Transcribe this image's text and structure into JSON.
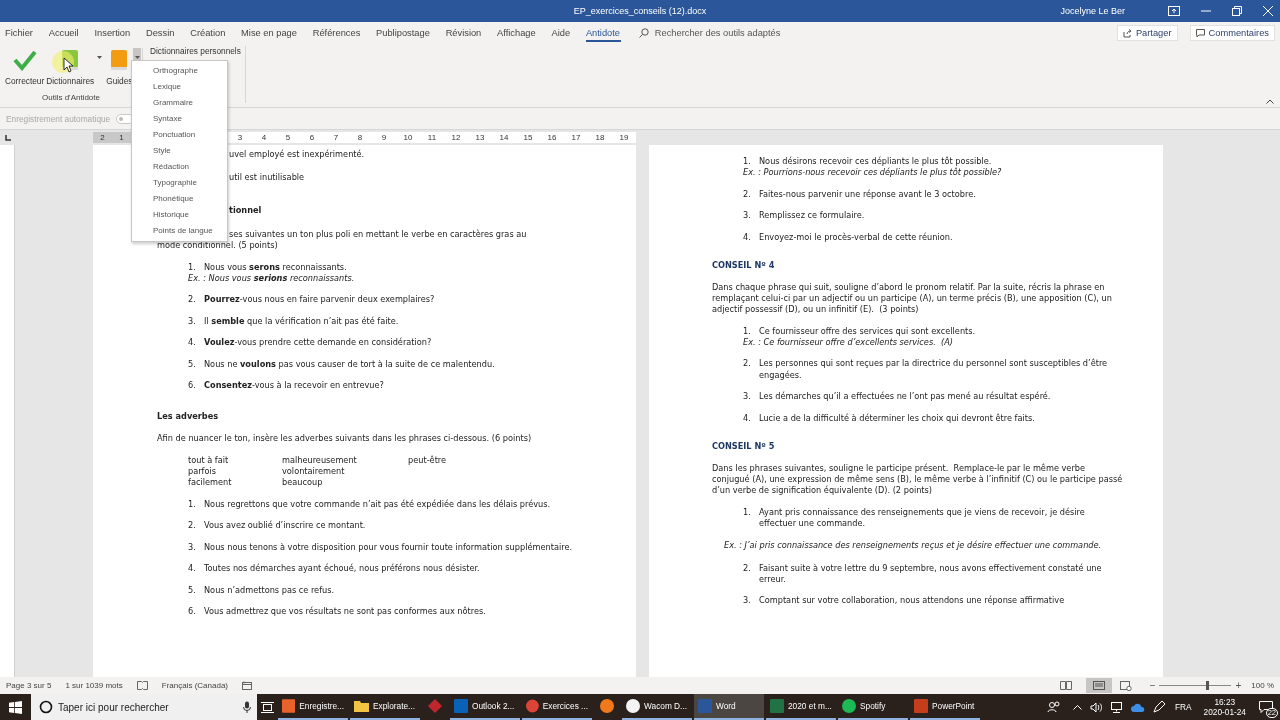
{
  "window": {
    "title": "EP_exercices_conseils (12).docx",
    "user": "Jocelyne Le Ber"
  },
  "tabs": [
    {
      "label": "Fichier",
      "selected": false
    },
    {
      "label": "Accueil",
      "selected": false
    },
    {
      "label": "Insertion",
      "selected": false
    },
    {
      "label": "Dessin",
      "selected": false
    },
    {
      "label": "Création",
      "selected": false
    },
    {
      "label": "Mise en page",
      "selected": false
    },
    {
      "label": "Références",
      "selected": false
    },
    {
      "label": "Publipostage",
      "selected": false
    },
    {
      "label": "Révision",
      "selected": false
    },
    {
      "label": "Affichage",
      "selected": false
    },
    {
      "label": "Aide",
      "selected": false
    },
    {
      "label": "Antidote",
      "selected": true
    }
  ],
  "search": {
    "placeholder": "Rechercher des outils adaptés"
  },
  "actions": [
    {
      "label": "Partager",
      "kind": "share"
    },
    {
      "label": "Commentaires",
      "kind": "comment"
    }
  ],
  "ribbon": {
    "buttons": [
      {
        "label": "Correcteur",
        "kind": "check",
        "color": "#3fae49"
      },
      {
        "label": "Dictionnaires",
        "kind": "book",
        "color": "#8cc63f",
        "expanded": false
      },
      {
        "label": "Guides",
        "kind": "book",
        "color": "#f39c12",
        "expanded": true
      }
    ],
    "group_label": "Outils d'Antidote",
    "personal_dictionaries": "Dictionnaires personnels"
  },
  "guides_menu": {
    "items": [
      "Orthographe",
      "Lexique",
      "Grammaire",
      "Syntaxe",
      "Ponctuation",
      "Style",
      "Rédaction",
      "Typographie",
      "Phonétique",
      "Historique",
      "Points de langue"
    ]
  },
  "quick_access": {
    "autosave_label": "Enregistrement automatique",
    "autosave_on": false
  },
  "ruler": {
    "left_numbers": [
      "2",
      "1"
    ],
    "numbers": [
      "3",
      "4",
      "5",
      "6",
      "7",
      "8",
      "9",
      "10",
      "11",
      "12",
      "13",
      "14",
      "15",
      "16",
      "17",
      "18",
      "19"
    ]
  },
  "pages": [
    {
      "blocks": [
        {
          "kind": "clipped_text",
          "text": "uvel employé est inexpérimenté."
        },
        {
          "kind": "clipped_text",
          "text": "util est inutilisable"
        },
        {
          "kind": "clipped_heading",
          "text": "tionnel"
        },
        {
          "kind": "clipped_line",
          "text": "ses suivantes un ton plus poli en mettant le verbe en caractères gras au"
        },
        {
          "kind": "paragraph",
          "text": "mode conditionnel. (5 points)"
        },
        {
          "kind": "list",
          "items": [
            {
              "number": "1.",
              "text": "Nous vous **serons** reconnaissants.",
              "example": "Ex. : Nous vous **serions** reconnaissants."
            },
            {
              "number": "2.",
              "text": "**Pourrez**-vous nous en faire parvenir deux exemplaires?"
            },
            {
              "number": "3.",
              "text": "Il **semble** que la vérification n’ait pas été faite."
            },
            {
              "number": "4.",
              "text": "**Voulez**-vous prendre cette demande en considération?"
            },
            {
              "number": "5.",
              "text": "Nous ne **voulons** pas vous causer de tort à la suite de ce malentendu."
            },
            {
              "number": "6.",
              "text": "**Consentez**-vous à la recevoir en entrevue?"
            }
          ]
        },
        {
          "kind": "heading",
          "text": "Les adverbes"
        },
        {
          "kind": "paragraph",
          "text": "Afin de nuancer le ton, insère les adverbes suivants dans les phrases ci-dessous. (6 points)"
        },
        {
          "kind": "word_bank",
          "columns": [
            [
              "tout à fait",
              "parfois",
              "facilement"
            ],
            [
              "malheureusement",
              "volontairement",
              "beaucoup"
            ],
            [
              "peut-être"
            ]
          ]
        },
        {
          "kind": "list",
          "items": [
            {
              "number": "1.",
              "text": "Nous regrettons que votre commande n’ait pas été expédiée dans les délais prévus."
            },
            {
              "number": "2.",
              "text": "Vous avez oublié d’inscrire ce montant."
            },
            {
              "number": "3.",
              "text": "Nous nous tenons à votre disposition pour vous fournir toute information supplémentaire."
            },
            {
              "number": "4.",
              "text": "Toutes nos démarches ayant échoué, nous préférons nous désister."
            },
            {
              "number": "5.",
              "text": "Nous n’admettons pas ce refus."
            },
            {
              "number": "6.",
              "text": "Vous admettrez que vos résultats ne sont pas conformes aux nôtres."
            }
          ]
        }
      ]
    },
    {
      "blocks": [
        {
          "kind": "list",
          "items": [
            {
              "number": "1.",
              "text": "Nous désirons recevoir ces dépliants le plus tôt possible.",
              "example": "Ex. : Pourrions-nous recevoir ces dépliants le plus tôt possible?"
            },
            {
              "number": "2.",
              "text": "Faites-nous parvenir une réponse avant le 3 octobre."
            },
            {
              "number": "3.",
              "text": "Remplissez ce formulaire."
            },
            {
              "number": "4.",
              "text": "Envoyez-moi le procès-verbal de cette réunion."
            }
          ]
        },
        {
          "kind": "conseil_heading",
          "text": "CONSEIL Nº 4"
        },
        {
          "kind": "paragraph",
          "text": "Dans chaque phrase qui suit, souligne d’abord le pronom relatif. Par la suite, récris la phrase en remplaçant celui-ci par un adjectif ou un participe (A), un terme précis (B), une apposition (C), un adjectif possessif (D), ou un infinitif (E).  (3 points)"
        },
        {
          "kind": "list",
          "items": [
            {
              "number": "1.",
              "text": "Ce fournisseur offre des services qui sont excellents.",
              "example": "Ex. : Ce fournisseur offre d’excellents services.  (A)"
            },
            {
              "number": "2.",
              "text": "Les personnes qui sont reçues par la directrice du personnel sont susceptibles d’être engagées."
            },
            {
              "number": "3.",
              "text": "Les démarches qu’il a effectuées ne l’ont pas mené au résultat espéré."
            },
            {
              "number": "4.",
              "text": "Lucie a de la difficulté à déterminer les choix qui devront être faits."
            }
          ]
        },
        {
          "kind": "conseil_heading",
          "text": "CONSEIL Nº 5"
        },
        {
          "kind": "paragraph",
          "text": "Dans les phrases suivantes, souligne le participe présent.  Remplace-le par le même verbe conjugué (A), une expression de même sens (B), le même verbe à l’infinitif (C) ou le participe passé d’un verbe de signification équivalente (D). (2 points)"
        },
        {
          "kind": "list",
          "items": [
            {
              "number": "1.",
              "text": "Ayant pris connaissance des renseignements que je viens de recevoir, je désire effectuer une commande."
            }
          ]
        },
        {
          "kind": "example",
          "text": "Ex. : J’ai pris connaissance des renseignements reçus et je désire effectuer une commande."
        },
        {
          "kind": "list",
          "items": [
            {
              "number": "2.",
              "text": "Faisant suite à votre lettre du 9 septembre, nous avons effectivement constaté une erreur."
            },
            {
              "number": "3.",
              "text": "Comptant sur votre collaboration, nous attendons une réponse affirmative"
            }
          ]
        }
      ]
    }
  ],
  "status_bar": {
    "page": "Page 3 sur 5",
    "words": "1 sur 1039 mots",
    "language": "Français (Canada)",
    "zoom_out": "−",
    "zoom_slider": {
      "level": 0.66
    },
    "zoom_in": "+",
    "zoom": "100 %"
  },
  "taskbar": {
    "search_placeholder": "Taper ici pour rechercher",
    "apps": [
      {
        "label": "Enregistre...",
        "kind": "tile",
        "color": "#e8632b",
        "selected": false
      },
      {
        "label": "Explorate...",
        "kind": "folder",
        "color": "#f2c443",
        "selected": false
      },
      {
        "kind": "diamond",
        "color": "#c0262d",
        "selected": false
      },
      {
        "label": "Outlook 2...",
        "kind": "tile",
        "color": "#0a62b6",
        "selected": false
      },
      {
        "label": "Exercices ...",
        "kind": "circle",
        "color": "#db4437",
        "selected": false
      },
      {
        "kind": "circle",
        "color": "#f07a1b",
        "selected": false
      },
      {
        "label": "Wacom D...",
        "kind": "circle",
        "color": "#f4f4f4",
        "selected": false
      },
      {
        "label": "Word",
        "kind": "tile",
        "color": "#2b579a",
        "selected": true
      },
      {
        "label": "2020 et m...",
        "kind": "tile",
        "color": "#217346",
        "selected": false
      },
      {
        "label": "Spotify",
        "kind": "circle",
        "color": "#1db954",
        "selected": false
      },
      {
        "label": "PowerPoint",
        "kind": "tile",
        "color": "#c43e1c",
        "selected": false
      }
    ],
    "language": "FRA",
    "time": "16:23",
    "date": "2020-01-24",
    "notifications": "22"
  }
}
